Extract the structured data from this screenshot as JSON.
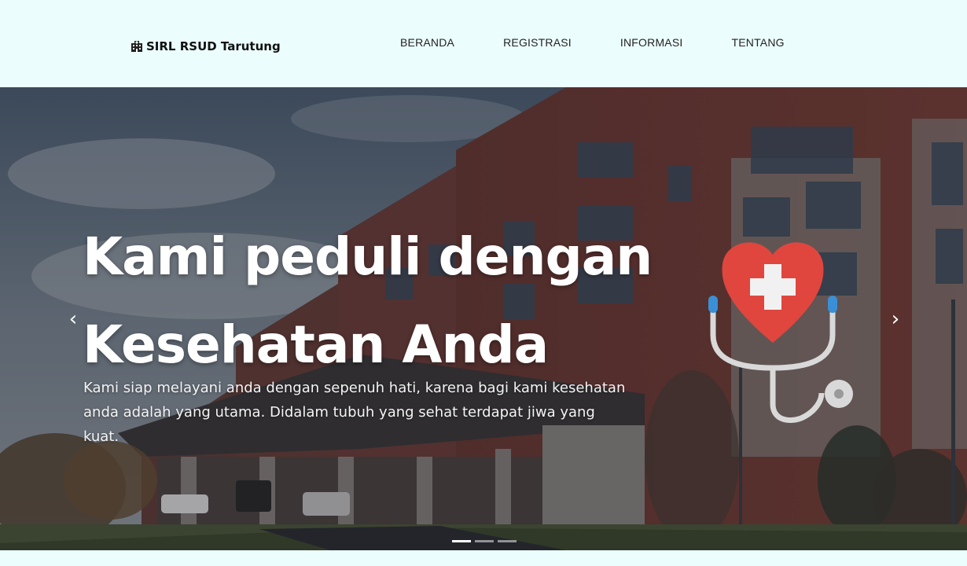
{
  "navbar": {
    "brand": "SIRL RSUD Tarutung",
    "brand_icon": "hospital-icon",
    "links": [
      "BERANDA",
      "REGISTRASI",
      "INFORMASI",
      "TENTANG"
    ]
  },
  "hero": {
    "headline_line1": "Kami peduli dengan",
    "headline_line2": "Kesehatan Anda",
    "subtext": "Kami siap melayani anda dengan sepenuh hati, karena bagi kami kesehatan anda adalah yang utama. Didalam tubuh yang sehat terdapat jiwa yang kuat.",
    "illustration": "heart-stethoscope-icon",
    "prev_icon": "chevron-left-icon",
    "next_icon": "chevron-right-icon",
    "prev_glyph": "‹",
    "next_glyph": "›",
    "slides_count": 3,
    "active_slide": 1
  },
  "colors": {
    "navbar_bg": "#ecfdfd",
    "heart": "#e0463e",
    "stethoscope": "#d9d9d9",
    "earpiece": "#3a8fd6"
  }
}
